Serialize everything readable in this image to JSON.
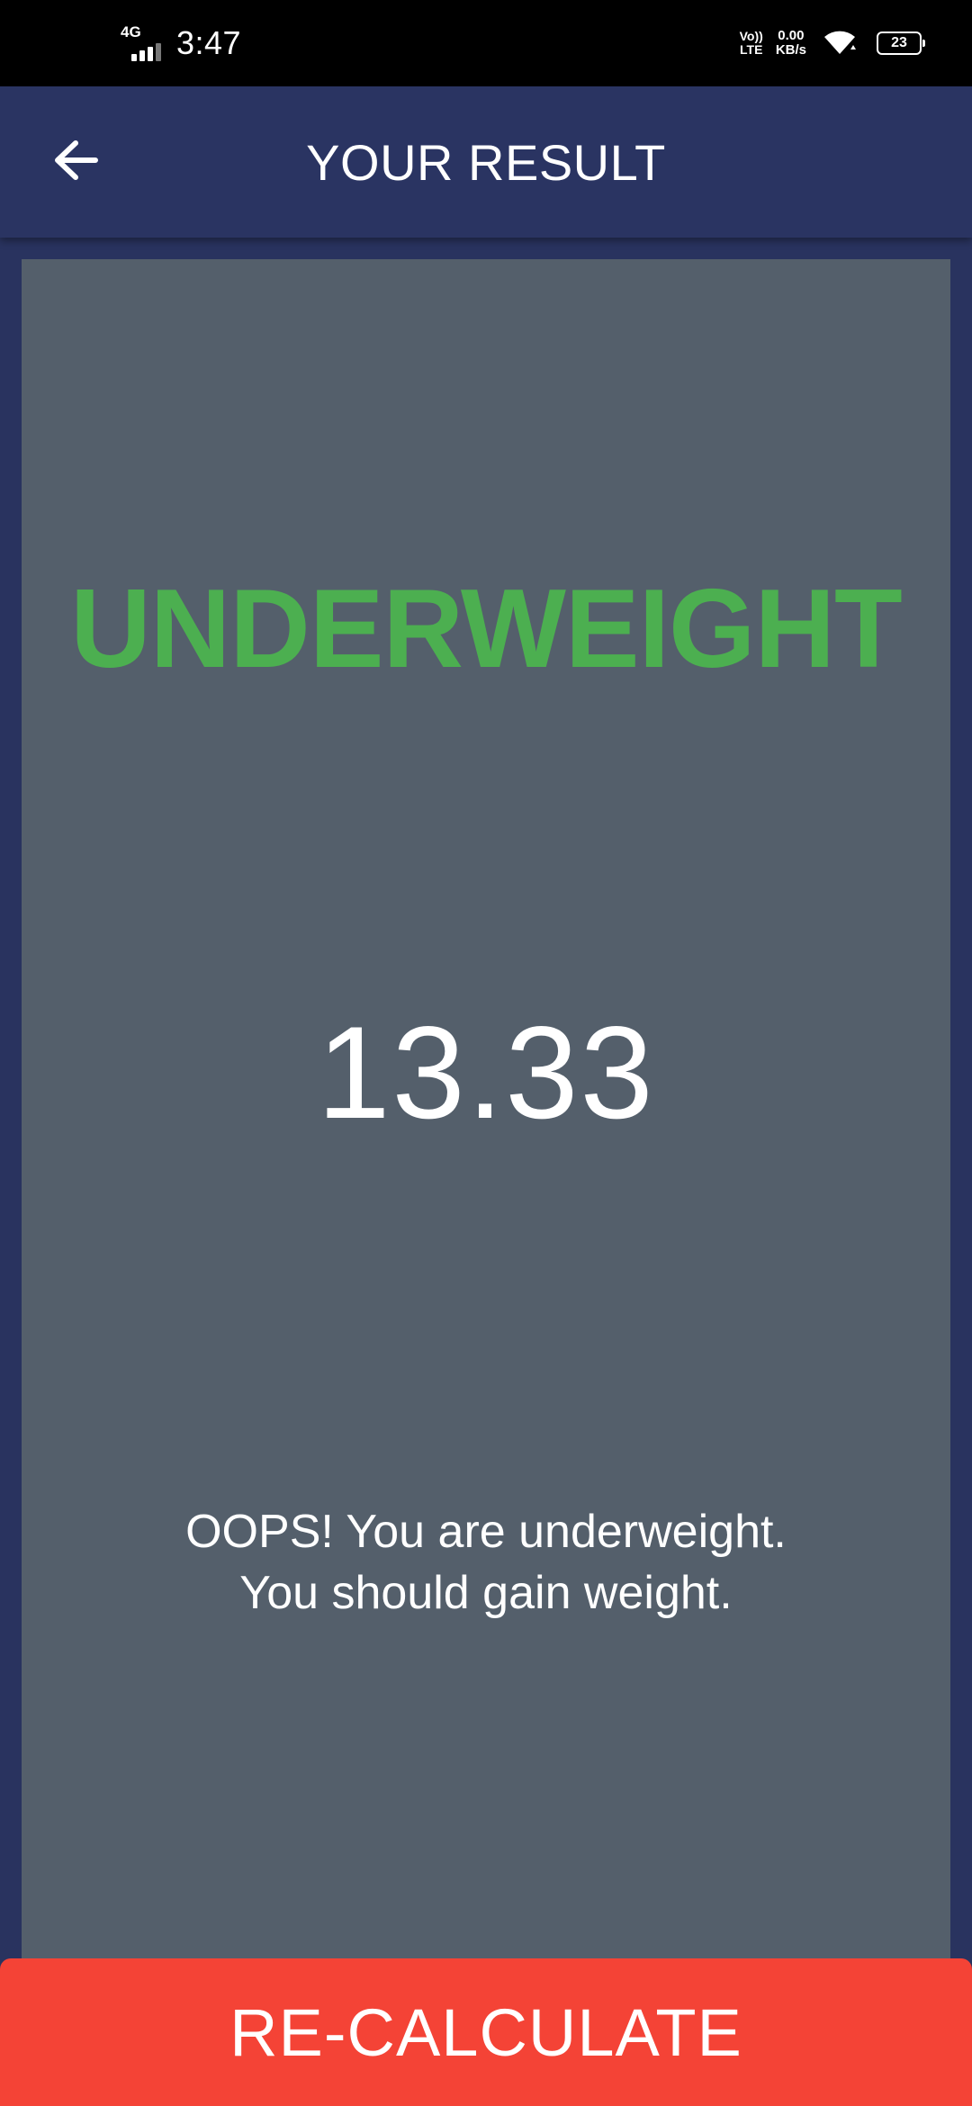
{
  "status_bar": {
    "network_type": "4G",
    "time": "3:47",
    "volte_line1": "Vo))",
    "volte_line2": "LTE",
    "speed_value": "0.00",
    "speed_unit": "KB/s",
    "battery_level": "23",
    "icons": [
      "signal-icon",
      "wifi-icon",
      "battery-icon"
    ]
  },
  "app_bar": {
    "title": "YOUR RESULT",
    "back_icon": "arrow-left-icon",
    "background_color": "#2a3462"
  },
  "result": {
    "category": "UNDERWEIGHT",
    "category_color": "#4caf50",
    "bmi_value": "13.33",
    "message_line1": "OOPS! You are underweight.",
    "message_line2": "You should gain weight.",
    "card_color": "#545f6b"
  },
  "actions": {
    "recalculate_label": "RE-CALCULATE",
    "recalculate_color": "#f44336"
  }
}
